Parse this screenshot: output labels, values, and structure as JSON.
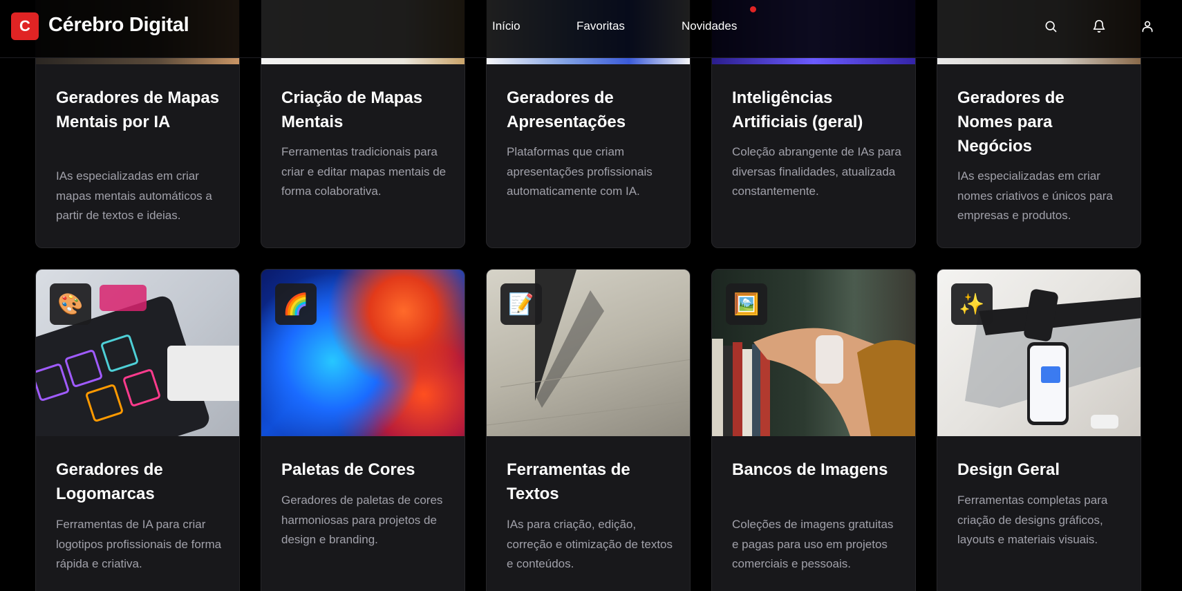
{
  "header": {
    "logo_letter": "C",
    "app_title": "Cérebro Digital",
    "nav": [
      "Início",
      "Favoritas",
      "Novidades"
    ],
    "icons": [
      "search-icon",
      "bell-icon",
      "user-icon"
    ],
    "accent_color": "#e02424"
  },
  "cards_top": [
    {
      "title": "Geradores de Mapas Mentais por IA",
      "description": "IAs especializadas em criar mapas mentais automáticos a partir de textos e ideias."
    },
    {
      "title": "Criação de Mapas Mentais",
      "description": "Ferramentas tradicionais para criar e editar mapas mentais de forma colaborativa."
    },
    {
      "title": "Geradores de Apresentações",
      "description": "Plataformas que criam apresentações profissionais automaticamente com IA."
    },
    {
      "title": "Inteligências Artificiais (geral)",
      "description": "Coleção abrangente de IAs para diversas finalidades, atualizada constantemente."
    },
    {
      "title": "Geradores de Nomes para Negócios",
      "description": "IAs especializadas em criar nomes criativos e únicos para empresas e produtos."
    }
  ],
  "cards_bottom": [
    {
      "emoji": "🎨",
      "icon": "palette-icon",
      "title": "Geradores de Logomarcas",
      "description": "Ferramentas de IA para criar logotipos profissionais de forma rápida e criativa."
    },
    {
      "emoji": "🌈",
      "icon": "rainbow-icon",
      "title": "Paletas de Cores",
      "description": "Geradores de paletas de cores harmoniosas para projetos de design e branding."
    },
    {
      "emoji": "📝",
      "icon": "memo-icon",
      "title": "Ferramentas de Textos",
      "description": "IAs para criação, edição, correção e otimização de textos e conteúdos."
    },
    {
      "emoji": "🖼️",
      "icon": "framed-picture-icon",
      "title": "Bancos de Imagens",
      "description": "Coleções de imagens gratuitas e pagas para uso em projetos comerciais e pessoais."
    },
    {
      "emoji": "✨",
      "icon": "sparkles-icon",
      "title": "Design Geral",
      "description": "Ferramentas completas para criação de designs gráficos, layouts e materiais visuais."
    }
  ]
}
